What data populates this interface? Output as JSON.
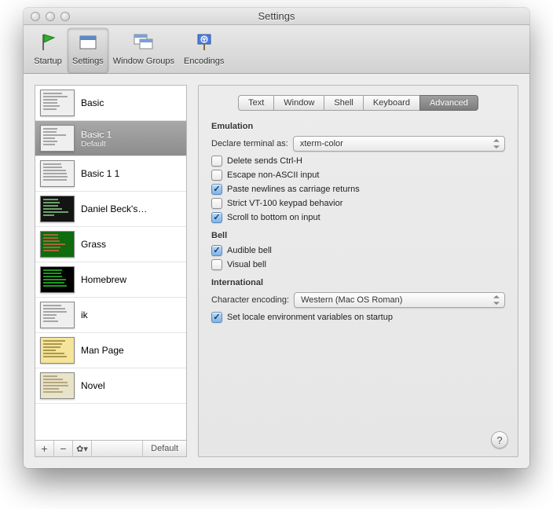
{
  "window": {
    "title": "Settings"
  },
  "toolbar": {
    "items": [
      {
        "label": "Startup"
      },
      {
        "label": "Settings"
      },
      {
        "label": "Window Groups"
      },
      {
        "label": "Encodings"
      }
    ]
  },
  "profiles": {
    "items": [
      {
        "name": "Basic",
        "bg": "#efefef",
        "fg": "#888"
      },
      {
        "name": "Basic 1",
        "sub": "Default",
        "bg": "#efefef",
        "fg": "#888"
      },
      {
        "name": "Basic 1 1",
        "bg": "#efefef",
        "fg": "#888"
      },
      {
        "name": "Daniel Beck's…",
        "bg": "#141414",
        "fg": "#8fe08f"
      },
      {
        "name": "Grass",
        "bg": "#0e6b0e",
        "fg": "#e96347"
      },
      {
        "name": "Homebrew",
        "bg": "#000000",
        "fg": "#2bd82b"
      },
      {
        "name": "ik",
        "bg": "#efefef",
        "fg": "#888"
      },
      {
        "name": "Man Page",
        "bg": "#f5e49a",
        "fg": "#8a7a2e"
      },
      {
        "name": "Novel",
        "bg": "#e9e3c9",
        "fg": "#9c8f64"
      }
    ],
    "selected_index": 1,
    "footer_default": "Default"
  },
  "tabs": {
    "items": [
      "Text",
      "Window",
      "Shell",
      "Keyboard",
      "Advanced"
    ],
    "selected_index": 4
  },
  "panel": {
    "emulation": {
      "title": "Emulation",
      "declare_label": "Declare terminal as:",
      "declare_value": "xterm-color",
      "options": [
        {
          "label": "Delete sends Ctrl-H",
          "checked": false
        },
        {
          "label": "Escape non-ASCII input",
          "checked": false
        },
        {
          "label": "Paste newlines as carriage returns",
          "checked": true
        },
        {
          "label": "Strict VT-100 keypad behavior",
          "checked": false
        },
        {
          "label": "Scroll to bottom on input",
          "checked": true
        }
      ]
    },
    "bell": {
      "title": "Bell",
      "options": [
        {
          "label": "Audible bell",
          "checked": true
        },
        {
          "label": "Visual bell",
          "checked": false
        }
      ]
    },
    "international": {
      "title": "International",
      "encoding_label": "Character encoding:",
      "encoding_value": "Western (Mac OS Roman)",
      "locale": {
        "label": "Set locale environment variables on startup",
        "checked": true
      }
    }
  }
}
